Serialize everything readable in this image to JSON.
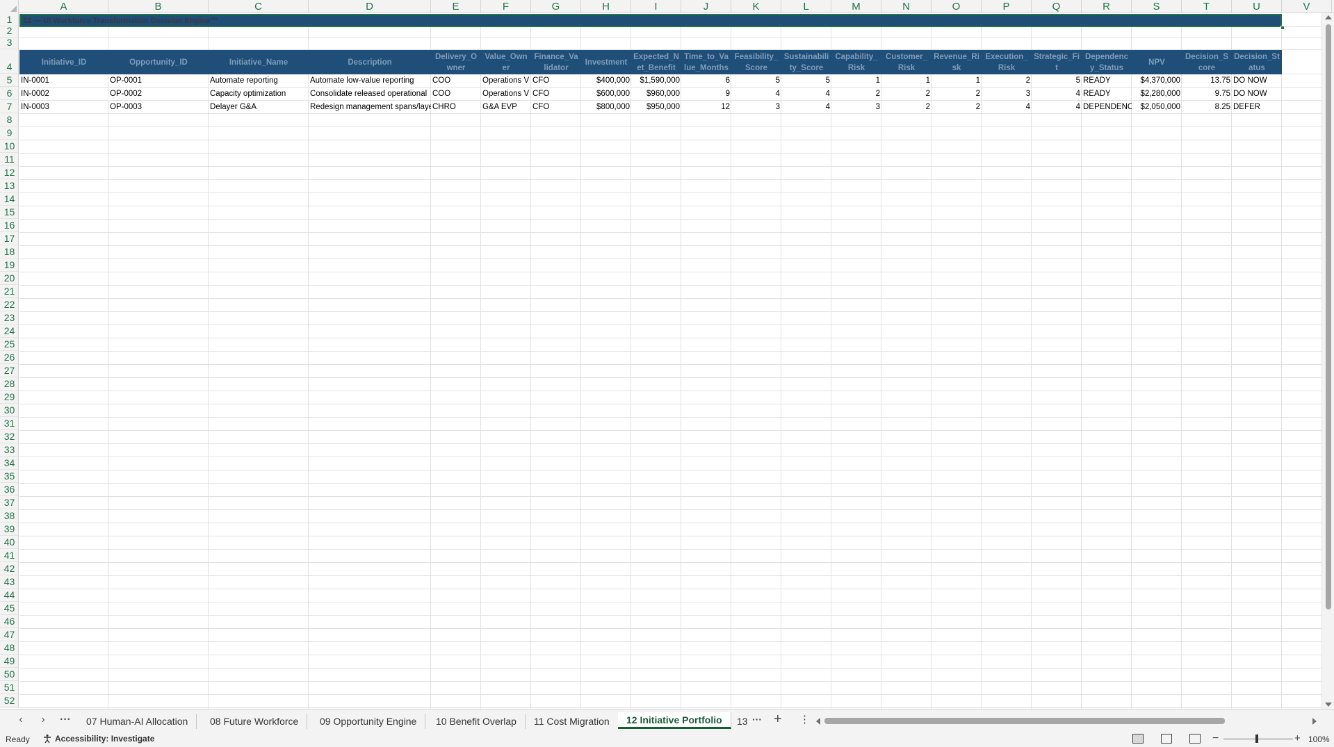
{
  "columns": [
    "A",
    "B",
    "C",
    "D",
    "E",
    "F",
    "G",
    "H",
    "I",
    "J",
    "K",
    "L",
    "M",
    "N",
    "O",
    "P",
    "Q",
    "R",
    "S",
    "T",
    "U",
    "V"
  ],
  "rows": [
    "1",
    "2",
    "3",
    "4",
    "5",
    "6",
    "7",
    "8",
    "9",
    "10",
    "11",
    "12",
    "13",
    "14",
    "15",
    "16",
    "17",
    "18",
    "19",
    "20",
    "21",
    "22",
    "23",
    "24",
    "25",
    "26",
    "27",
    "28",
    "29",
    "30",
    "31",
    "32",
    "33",
    "34",
    "35",
    "36",
    "37",
    "38",
    "39",
    "40",
    "41",
    "42",
    "43",
    "44",
    "45",
    "46",
    "47",
    "48",
    "49",
    "50",
    "51",
    "52"
  ],
  "sheet": {
    "title": "12 — UI Workforce Transformation Decision Engine™",
    "headers": [
      "Initiative_ID",
      "Opportunity_ID",
      "Initiative_Name",
      "Description",
      "Delivery_O\nwner",
      "Value_Own\ner",
      "Finance_Va\nlidator",
      "Investment",
      "Expected_N\net_Benefit",
      "Time_to_Va\nlue_Months",
      "Feasibility_\nScore",
      "Sustainabili\nty_Score",
      "Capability_\nRisk",
      "Customer_\nRisk",
      "Revenue_Ri\nsk",
      "Execution_\nRisk",
      "Strategic_Fi\nt",
      "Dependenc\ny_Status",
      "NPV",
      "Decision_S\ncore",
      "Decision_St\natus"
    ],
    "data_rows": [
      [
        "IN-0001",
        "OP-0001",
        "Automate reporting",
        "Automate low-value reporting",
        "COO",
        "Operations V",
        "CFO",
        "$400,000",
        "$1,590,000",
        "6",
        "5",
        "5",
        "1",
        "1",
        "1",
        "2",
        "5",
        "READY",
        "$4,370,000",
        "13.75",
        "DO NOW"
      ],
      [
        "IN-0002",
        "OP-0002",
        "Capacity optimization",
        "Consolidate released operational",
        "COO",
        "Operations V",
        "CFO",
        "$600,000",
        "$960,000",
        "9",
        "4",
        "4",
        "2",
        "2",
        "2",
        "3",
        "4",
        "READY",
        "$2,280,000",
        "9.75",
        "DO NOW"
      ],
      [
        "IN-0003",
        "OP-0003",
        "Delayer G&A",
        "Redesign management spans/laye",
        "CHRO",
        "G&A EVP",
        "CFO",
        "$800,000",
        "$950,000",
        "12",
        "3",
        "4",
        "3",
        "2",
        "2",
        "4",
        "4",
        "DEPENDENC",
        "$2,050,000",
        "8.25",
        "DEFER"
      ]
    ]
  },
  "tabs": {
    "items": [
      "07 Human-AI Allocation",
      "08 Future Workforce",
      "09 Opportunity Engine",
      "10 Benefit Overlap",
      "11 Cost Migration",
      "12 Initiative Portfolio"
    ],
    "active_index": 5,
    "partial": "13"
  },
  "status": {
    "ready": "Ready",
    "accessibility": "Accessibility: Investigate",
    "zoom": "100%"
  },
  "icons": {
    "prev_sheet": "chevron-left-icon",
    "next_sheet": "chevron-right-icon",
    "more_sheets": "more-horizontal-icon",
    "add_sheet": "plus-icon",
    "accessibility": "accessibility-icon",
    "normal_view": "normal-view-icon",
    "page_layout": "page-layout-icon",
    "page_break": "page-break-icon"
  },
  "colors": {
    "header_fill": "#1f4e79",
    "accent": "#217346",
    "active_tab": "#185c37"
  }
}
